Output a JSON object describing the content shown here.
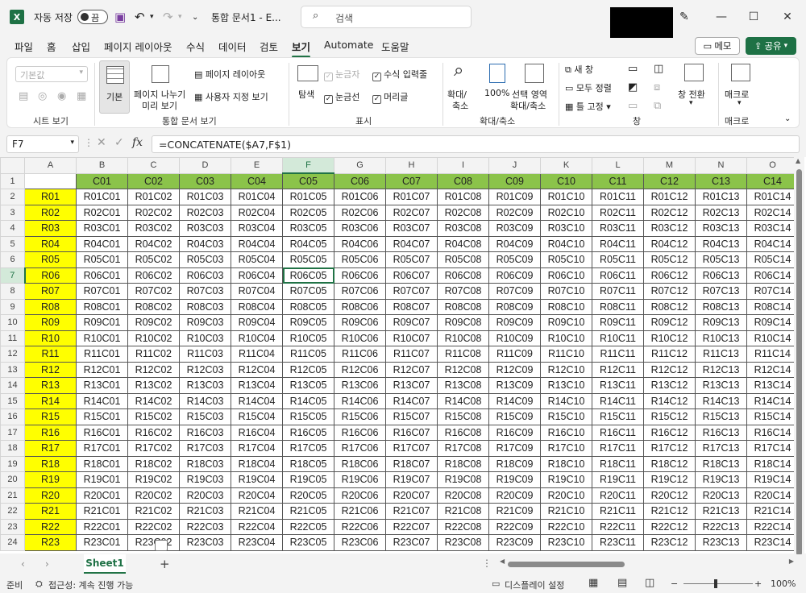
{
  "titlebar": {
    "autosave_label": "자동 저장",
    "autosave_state": "끔",
    "doc_title": "통합 문서1 - E...",
    "search_placeholder": "검색"
  },
  "menu": {
    "tabs": [
      "파일",
      "홈",
      "삽입",
      "페이지 레이아웃",
      "수식",
      "데이터",
      "검토",
      "보기",
      "Automate",
      "도움말"
    ],
    "active_tab": "보기",
    "memo_label": "메모",
    "share_label": "공유"
  },
  "ribbon": {
    "sheet_view": {
      "default_label": "기본값",
      "group": "시트 보기"
    },
    "workbook_views": {
      "normal": "기본",
      "page_break": "페이지 나누기 미리 보기",
      "page_layout": "페이지 레이아웃",
      "custom": "사용자 지정 보기",
      "group": "통합 문서 보기"
    },
    "show": {
      "navigation": "탐색",
      "ruler": "눈금자",
      "formula_bar": "수식 입력줄",
      "gridlines": "눈금선",
      "headings": "머리글",
      "group": "표시"
    },
    "zoom": {
      "zoom": "확대/축소",
      "hundred": "100%",
      "selection": "선택 영역 확대/축소",
      "group": "확대/축소"
    },
    "window": {
      "new_window": "새 창",
      "arrange_all": "모두 정렬",
      "freeze": "틀 고정",
      "switch": "창 전환",
      "group": "창"
    },
    "macros": {
      "label": "매크로",
      "group": "매크로"
    }
  },
  "formula_bar": {
    "name_box": "F7",
    "formula": "=CONCATENATE($A7,F$1)"
  },
  "grid": {
    "col_letters": [
      "A",
      "B",
      "C",
      "D",
      "E",
      "F",
      "G",
      "H",
      "I",
      "J",
      "K",
      "L",
      "M",
      "N",
      "O"
    ],
    "selected_col": "F",
    "selected_row": 7,
    "header_row": [
      "",
      "C01",
      "C02",
      "C03",
      "C04",
      "C05",
      "C06",
      "C07",
      "C08",
      "C09",
      "C10",
      "C11",
      "C12",
      "C13",
      "C14"
    ],
    "row_labels": [
      "R01",
      "R02",
      "R03",
      "R04",
      "R05",
      "R06",
      "R07",
      "R08",
      "R09",
      "R10",
      "R11",
      "R12",
      "R13",
      "R14",
      "R15",
      "R16",
      "R17",
      "R18",
      "R19",
      "R20",
      "R21",
      "R22",
      "R23"
    ]
  },
  "sheet_tabs": {
    "active": "Sheet1"
  },
  "status": {
    "ready": "준비",
    "accessibility": "접근성: 계속 진행 가능",
    "display_settings": "디스플레이 설정",
    "zoom": "100%"
  }
}
